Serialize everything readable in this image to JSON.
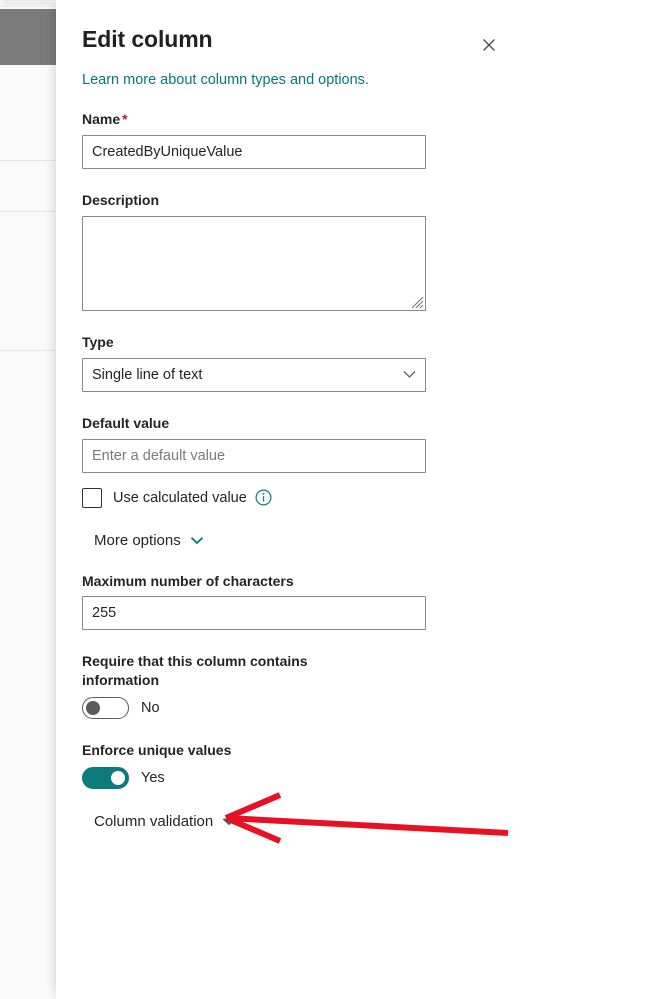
{
  "panel": {
    "title": "Edit column",
    "close_icon": "close-icon",
    "learn_more_link": "Learn more about column types and options.",
    "accent_color": "#03787c",
    "fields": {
      "name": {
        "label": "Name",
        "required_marker": "*",
        "value": "CreatedByUniqueValue"
      },
      "description": {
        "label": "Description",
        "value": "",
        "placeholder": ""
      },
      "type": {
        "label": "Type",
        "selected": "Single line of text",
        "chevron_icon": "chevron-down-icon"
      },
      "default_value": {
        "label": "Default value",
        "value": "",
        "placeholder": "Enter a default value"
      },
      "use_calculated_value": {
        "label": "Use calculated value",
        "checked": false,
        "info_icon": "info-icon"
      },
      "more_options": {
        "label": "More options",
        "chevron_icon": "chevron-down-icon"
      },
      "max_characters": {
        "label": "Maximum number of characters",
        "value": "255"
      },
      "require_information": {
        "label": "Require that this column contains information",
        "state": "No",
        "on": false
      },
      "enforce_unique_values": {
        "label": "Enforce unique values",
        "state": "Yes",
        "on": true
      },
      "column_validation": {
        "label": "Column validation",
        "chevron_icon": "chevron-down-icon"
      }
    }
  },
  "annotation": {
    "arrow_color": "#e81123",
    "points_to": "enforce-unique-values-toggle"
  }
}
